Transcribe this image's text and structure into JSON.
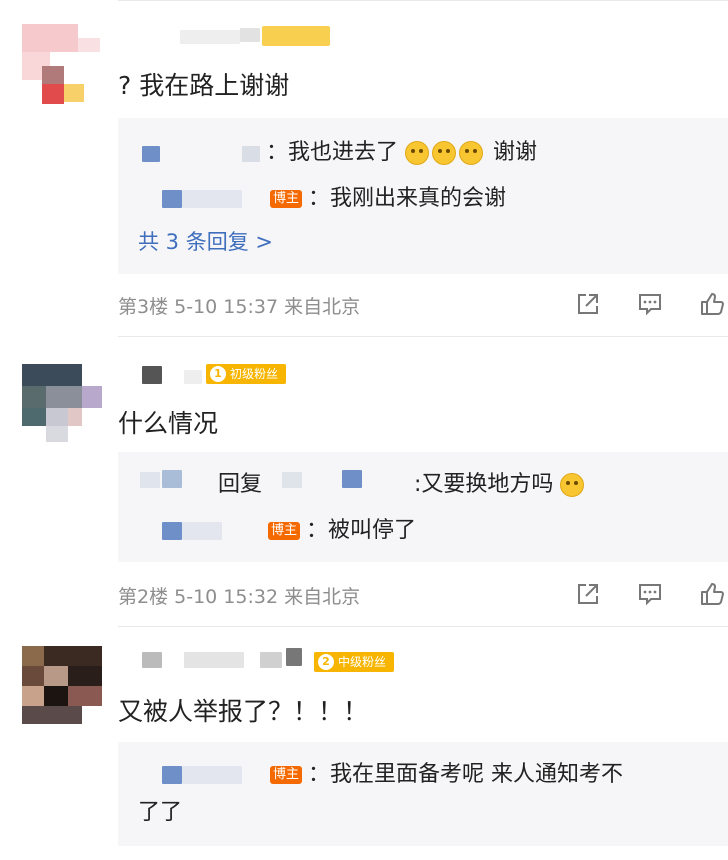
{
  "comments": [
    {
      "text": "? 我在路上谢谢",
      "replies": [
        {
          "content": "：我也进去了",
          "trail": "谢谢",
          "emoji_count": 3,
          "bozhu": false
        },
        {
          "content": "：我刚出来真的会谢",
          "bozhu": true
        }
      ],
      "more": "共 3 条回复 >",
      "meta": "第3楼 5-10 15:37 来自北京"
    },
    {
      "badge": {
        "level": "1",
        "label": "初级粉丝"
      },
      "text": "什么情况",
      "replies": [
        {
          "prefix": "回复",
          "content": ":又要换地方吗",
          "emoji": "crying",
          "bozhu": false
        },
        {
          "content": "：被叫停了",
          "bozhu": true
        }
      ],
      "meta": "第2楼 5-10 15:32 来自北京"
    },
    {
      "badge": {
        "level": "2",
        "label": "中级粉丝"
      },
      "text": "又被人举报了？！！！",
      "replies": [
        {
          "content": "：我在里面备考呢 来人通知考不",
          "content2": "了了",
          "bozhu": true
        }
      ]
    }
  ],
  "bozhu_label": "博主",
  "icons": [
    "share-icon",
    "comment-icon",
    "like-icon"
  ],
  "colors": {
    "link": "#3f6ebd",
    "meta": "#8e8e8e",
    "badge": "#f7b500",
    "bozhu": "#f56a00",
    "reply_bg": "#f6f6f8"
  }
}
